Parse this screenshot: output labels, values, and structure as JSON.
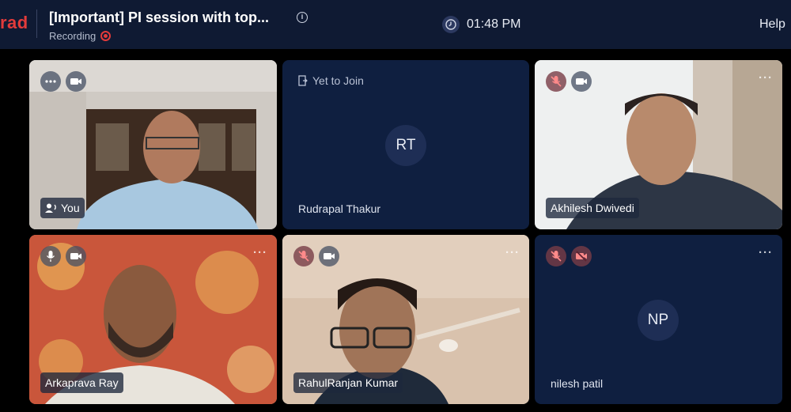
{
  "header": {
    "brand": "rad",
    "title": "[Important] PI session with top...",
    "recording_label": "Recording",
    "time": "01:48 PM",
    "help": "Help"
  },
  "tiles": [
    {
      "name": "You",
      "state": "video",
      "mic": "on",
      "cam": "on"
    },
    {
      "name": "Rudrapal Thakur",
      "state": "yet-to-join",
      "status": "Yet to Join",
      "initials": "RT"
    },
    {
      "name": "Akhilesh Dwivedi",
      "state": "video",
      "mic": "muted",
      "cam": "on"
    },
    {
      "name": "Arkaprava Ray",
      "state": "video",
      "mic": "on",
      "cam": "on"
    },
    {
      "name": "RahulRanjan Kumar",
      "state": "video",
      "mic": "muted",
      "cam": "on"
    },
    {
      "name": "nilesh patil",
      "state": "no-video",
      "initials": "NP",
      "mic": "muted",
      "cam": "off"
    }
  ],
  "colors": {
    "accent": "#e23b3b",
    "topbar": "#0f1a33",
    "tile": "#0f1f40"
  }
}
